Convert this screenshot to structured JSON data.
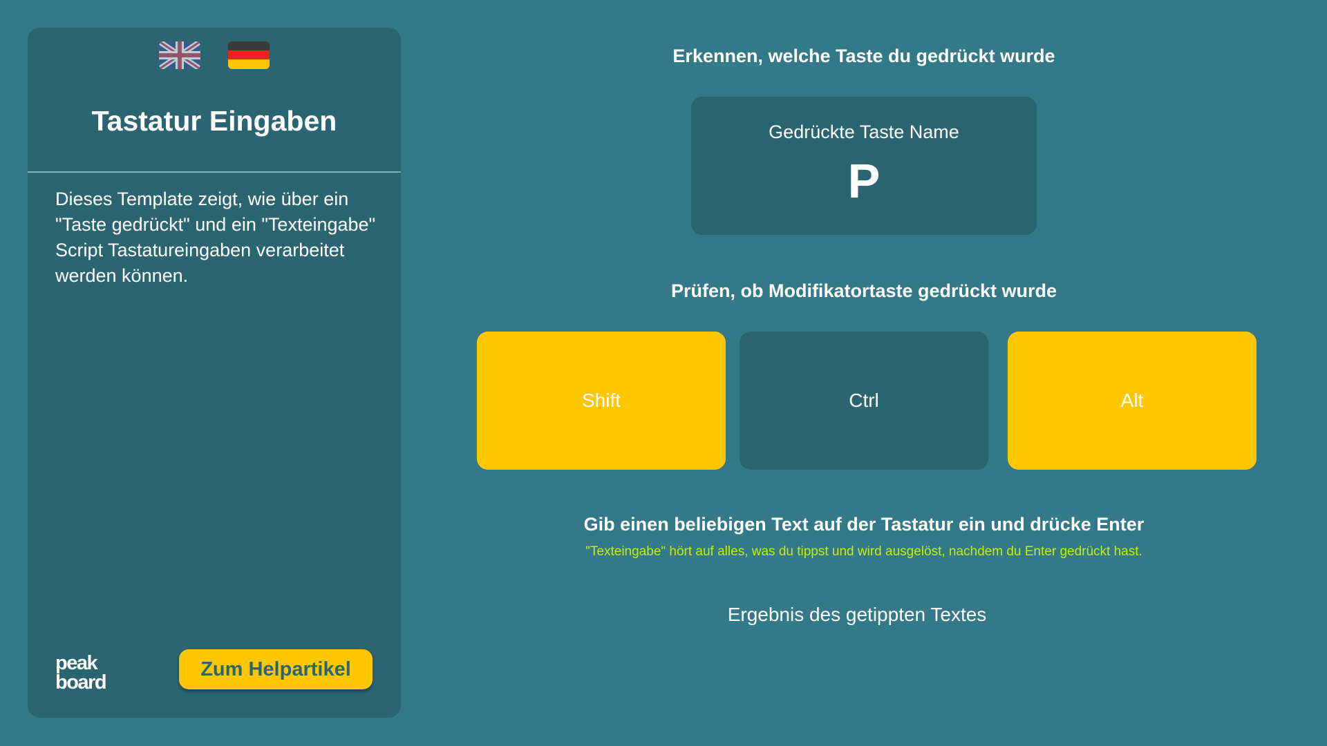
{
  "sidebar": {
    "languages": [
      "English",
      "Deutsch"
    ],
    "title": "Tastatur Eingaben",
    "description": "Dieses Template zeigt, wie über ein \"Taste gedrückt\" und ein \"Texteingabe\" Script Tastatureingaben verarbeitet werden können.",
    "logo_text": [
      "peak",
      "board"
    ],
    "help_button": "Zum Helpartikel"
  },
  "main": {
    "section1_heading": "Erkennen, welche Taste du gedrückt wurde",
    "pressed_key": {
      "label": "Gedrückte Taste Name",
      "value": "P"
    },
    "section2_heading": "Prüfen, ob Modifikatortaste gedrückt wurde",
    "modifiers": [
      {
        "label": "Shift",
        "active": true
      },
      {
        "label": "Ctrl",
        "active": false
      },
      {
        "label": "Alt",
        "active": true
      }
    ],
    "section3_heading": "Gib einen beliebigen Text auf der Tastatur ein und drücke Enter",
    "section3_note": "\"Texteingabe\" hört auf alles, was du tippst und wird ausgelöst, nachdem du Enter gedrückt hast.",
    "result_text": "Ergebnis des getippten Textes"
  },
  "colors": {
    "background": "#337988",
    "panel": "#2b6572",
    "accent": "#ffc700",
    "note": "#c7f000"
  }
}
